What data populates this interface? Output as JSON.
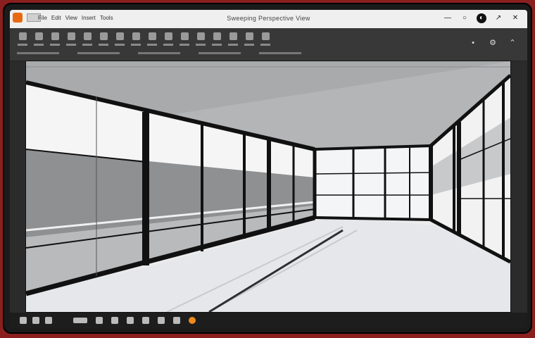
{
  "window": {
    "title": "Sweeping Perspective View",
    "menu": [
      "File",
      "Edit",
      "View",
      "Insert",
      "Tools"
    ]
  },
  "toolbar": {
    "tools": [
      "select-icon",
      "camera-icon",
      "orbit-icon",
      "pan-icon",
      "zoom-icon",
      "wall-icon",
      "window-icon",
      "door-icon",
      "floor-icon",
      "roof-icon",
      "material-icon",
      "render-icon",
      "light-icon",
      "section-icon",
      "export-icon",
      "settings-icon"
    ]
  },
  "colors": {
    "accent": "#e86a10",
    "frame": "#111111",
    "glass": "#f6f6f6",
    "ceiling": "#a9aaac",
    "floor": "#e8e8ec"
  },
  "taskbar": {
    "apps": [
      "start-icon",
      "search-icon",
      "browser-icon",
      "files-icon",
      "mail-icon",
      "media-icon",
      "app-icon"
    ]
  }
}
